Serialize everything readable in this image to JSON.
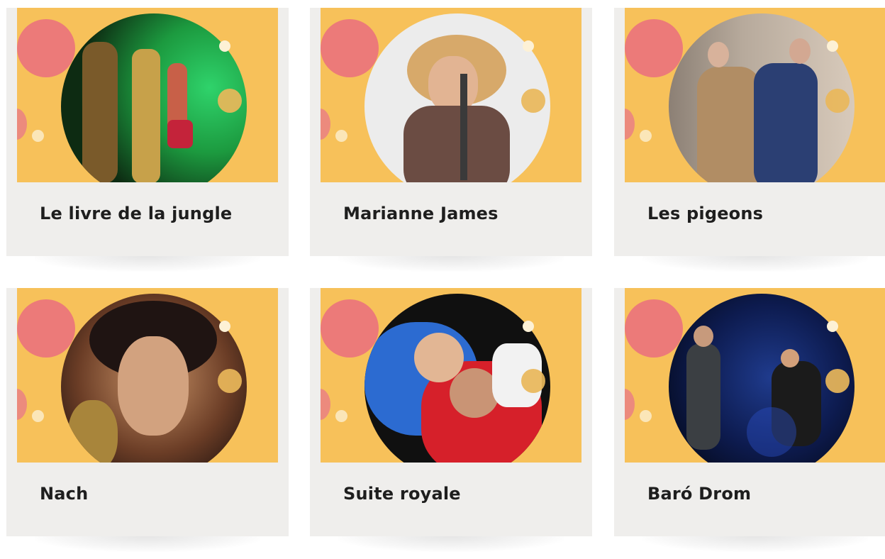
{
  "cards": [
    {
      "title": "Le livre de la jungle",
      "image": "jungle-book-stage-photo"
    },
    {
      "title": "Marianne James",
      "image": "singer-portrait-photo"
    },
    {
      "title": "Les pigeons",
      "image": "theatre-scene-photo"
    },
    {
      "title": "Nach",
      "image": "portrait-photo"
    },
    {
      "title": "Suite royale",
      "image": "couple-photo"
    },
    {
      "title": "Baró Drom",
      "image": "dance-stage-photo"
    }
  ],
  "colors": {
    "banner": "#f7c15a",
    "pink": "#ec7a79",
    "card_bg": "#efeeec",
    "title": "#1e1e1e"
  }
}
